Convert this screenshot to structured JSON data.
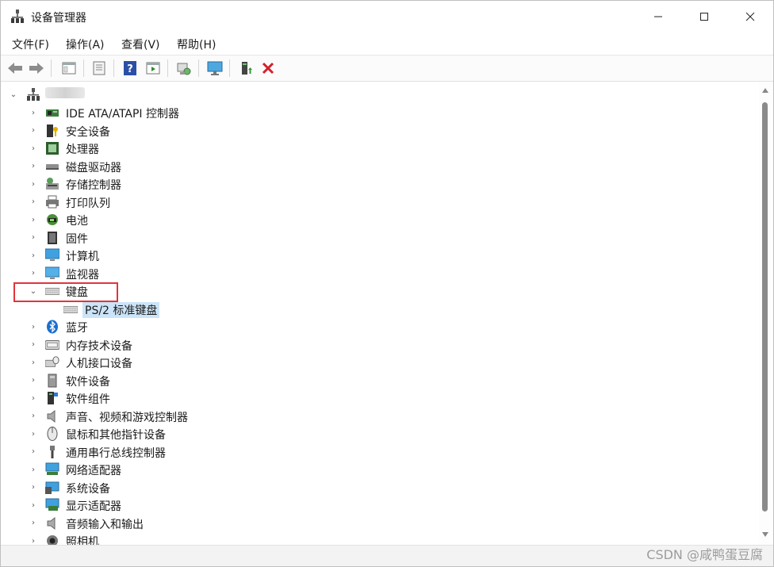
{
  "window": {
    "title": "设备管理器"
  },
  "menu": [
    "文件(F)",
    "操作(A)",
    "查看(V)",
    "帮助(H)"
  ],
  "toolbar": [
    "back-icon",
    "forward-icon",
    "properties-panel-icon",
    "view-icon",
    "help-icon",
    "action-panel-icon",
    "scan-hardware-icon",
    "monitor-icon",
    "enable-device-icon",
    "uninstall-icon"
  ],
  "tree": {
    "root": {
      "label": ""
    },
    "items": [
      {
        "label": "IDE ATA/ATAPI 控制器",
        "icon": "ide-controller-icon",
        "expanded": false
      },
      {
        "label": "安全设备",
        "icon": "security-device-icon",
        "expanded": false
      },
      {
        "label": "处理器",
        "icon": "processor-icon",
        "expanded": false
      },
      {
        "label": "磁盘驱动器",
        "icon": "disk-drive-icon",
        "expanded": false
      },
      {
        "label": "存储控制器",
        "icon": "storage-controller-icon",
        "expanded": false
      },
      {
        "label": "打印队列",
        "icon": "printer-icon",
        "expanded": false
      },
      {
        "label": "电池",
        "icon": "battery-icon",
        "expanded": false
      },
      {
        "label": "固件",
        "icon": "firmware-icon",
        "expanded": false
      },
      {
        "label": "计算机",
        "icon": "computer-icon",
        "expanded": false
      },
      {
        "label": "监视器",
        "icon": "monitor-icon",
        "expanded": false
      },
      {
        "label": "键盘",
        "icon": "keyboard-icon",
        "expanded": true
      },
      {
        "label": "PS/2 标准键盘",
        "icon": "keyboard-device-icon",
        "child": true,
        "selected": true
      },
      {
        "label": "蓝牙",
        "icon": "bluetooth-icon",
        "expanded": false
      },
      {
        "label": "内存技术设备",
        "icon": "memory-device-icon",
        "expanded": false
      },
      {
        "label": "人机接口设备",
        "icon": "hid-icon",
        "expanded": false
      },
      {
        "label": "软件设备",
        "icon": "software-device-icon",
        "expanded": false
      },
      {
        "label": "软件组件",
        "icon": "software-component-icon",
        "expanded": false
      },
      {
        "label": "声音、视频和游戏控制器",
        "icon": "sound-icon",
        "expanded": false
      },
      {
        "label": "鼠标和其他指针设备",
        "icon": "mouse-icon",
        "expanded": false
      },
      {
        "label": "通用串行总线控制器",
        "icon": "usb-icon",
        "expanded": false
      },
      {
        "label": "网络适配器",
        "icon": "network-adapter-icon",
        "expanded": false
      },
      {
        "label": "系统设备",
        "icon": "system-device-icon",
        "expanded": false
      },
      {
        "label": "显示适配器",
        "icon": "display-adapter-icon",
        "expanded": false
      },
      {
        "label": "音频输入和输出",
        "icon": "audio-io-icon",
        "expanded": false
      },
      {
        "label": "照相机",
        "icon": "camera-icon",
        "expanded": false
      }
    ]
  },
  "watermark": "CSDN @咸鸭蛋豆腐",
  "colors": {
    "selection": "#cce4f7",
    "highlight_box": "#e2343c",
    "accent": "#0067c0"
  }
}
